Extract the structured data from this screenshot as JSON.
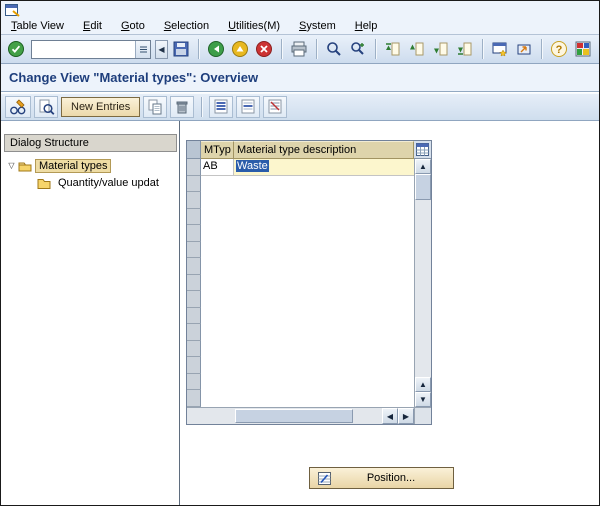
{
  "menu_bar": {
    "items": [
      "Table View",
      "Edit",
      "Goto",
      "Selection",
      "Utilities(M)",
      "System",
      "Help"
    ]
  },
  "toolbar": {
    "command_field": {
      "value": "",
      "placeholder": ""
    },
    "icons": [
      "enter-icon",
      "command-field-list-icon",
      "command-field-collapse-icon",
      "save-icon",
      "back-icon",
      "exit-icon",
      "cancel-icon",
      "print-icon",
      "find-icon",
      "find-next-icon",
      "first-page-icon",
      "previous-page-icon",
      "next-page-icon",
      "last-page-icon",
      "new-session-icon",
      "create-shortcut-icon",
      "help-icon",
      "customize-layout-icon"
    ]
  },
  "title": {
    "text": "Change View \"Material types\": Overview"
  },
  "app_toolbar": {
    "new_entries_label": "New Entries",
    "icons": [
      "change-display-icon",
      "overview-icon",
      "copy-as-icon",
      "delete-icon",
      "select-all-icon",
      "select-block-icon",
      "deselect-all-icon"
    ]
  },
  "dialog_structure": {
    "header": "Dialog Structure",
    "tree": [
      {
        "label": "Material types",
        "expanded": true,
        "selected": true,
        "level": 0
      },
      {
        "label": "Quantity/value updat",
        "expanded": false,
        "selected": false,
        "level": 1
      }
    ]
  },
  "table": {
    "columns": [
      "MTyp",
      "Material type description"
    ],
    "rows": [
      {
        "mtyp": "AB",
        "description": "Waste",
        "description_text_selected": true
      }
    ],
    "empty_rows": 14
  },
  "position_button": {
    "label": "Position..."
  },
  "colors": {
    "title_text": "#1e3e7c",
    "band_background": "#edf3fb",
    "table_header": "#ded4ab",
    "row_selector": "#cbd2da",
    "edit_cell": "#fcf6cd",
    "text_selection": "#2a5caa",
    "button_face": "#f3e3ba",
    "tree_selection": "#eedca4"
  }
}
